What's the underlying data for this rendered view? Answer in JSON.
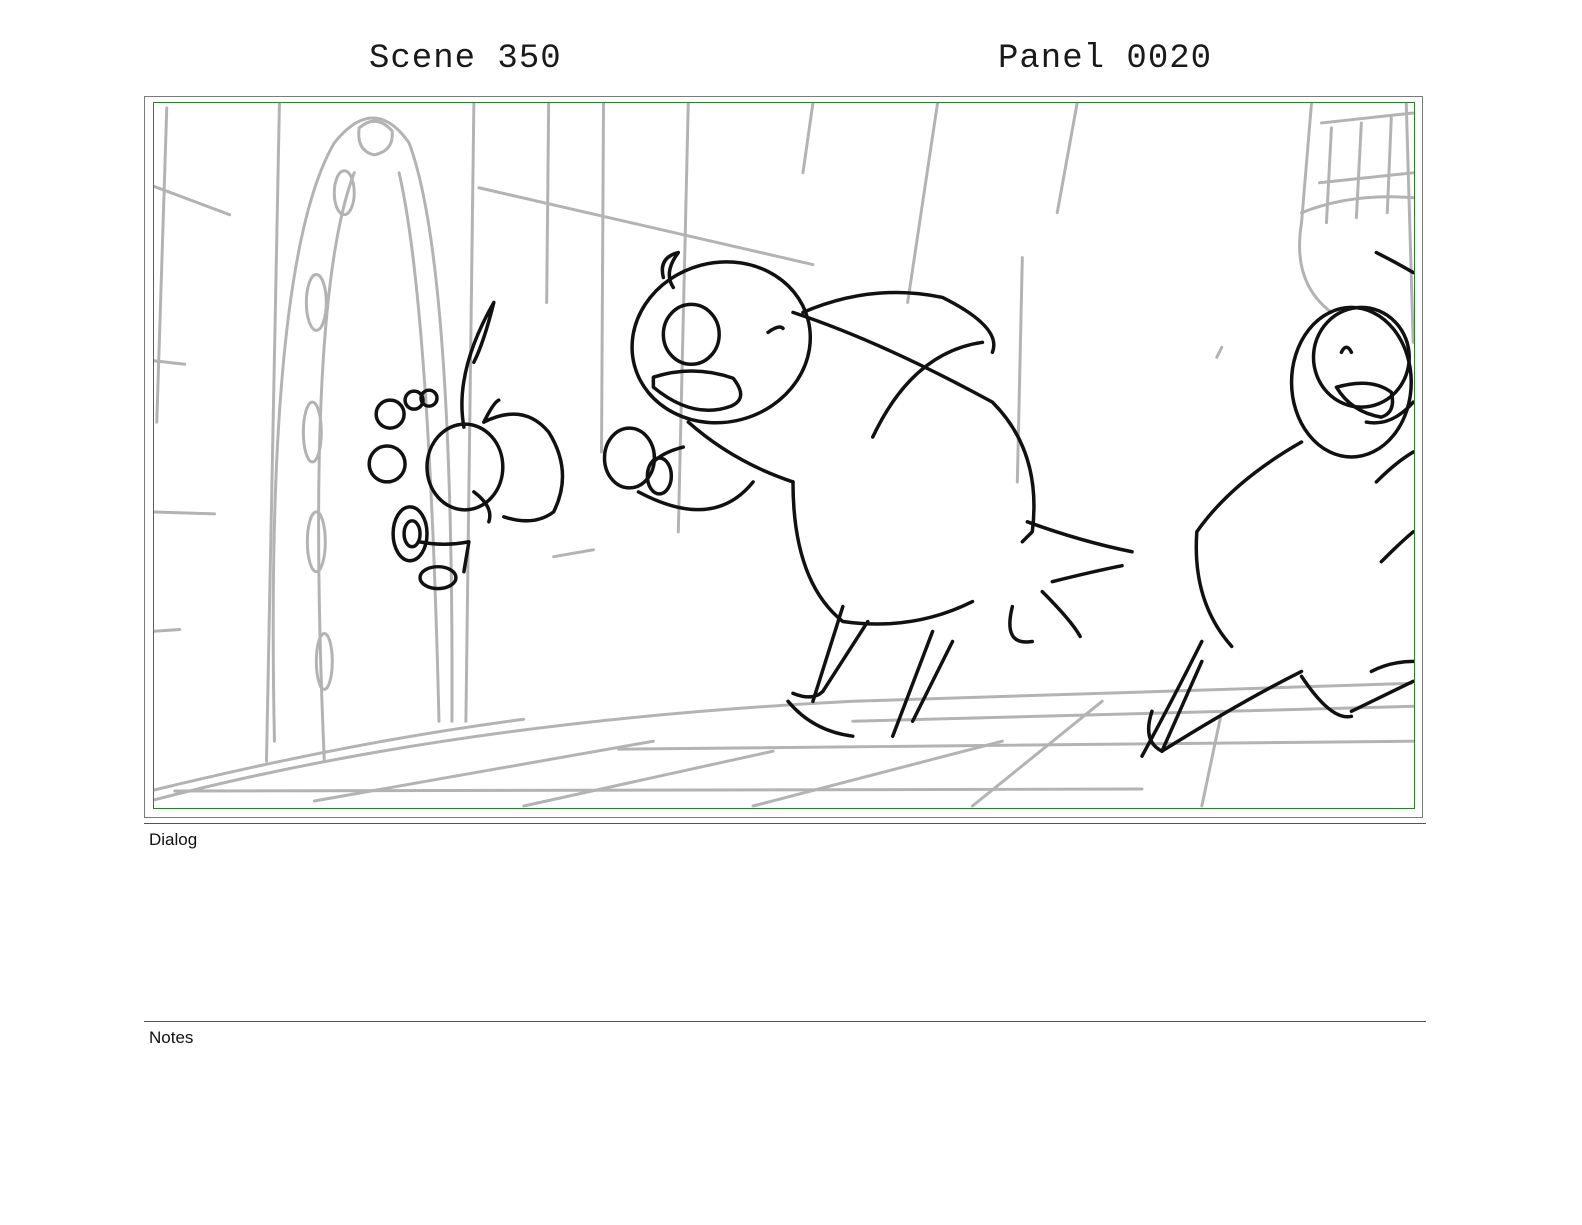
{
  "header": {
    "scene": "Scene 350",
    "panel": "Panel 0020"
  },
  "panel_image": {
    "description_icon": "storyboard-sketch",
    "frame_color": "#2e7d32"
  },
  "dialog": {
    "label": "Dialog",
    "text": ""
  },
  "notes": {
    "label": "Notes",
    "text": ""
  }
}
